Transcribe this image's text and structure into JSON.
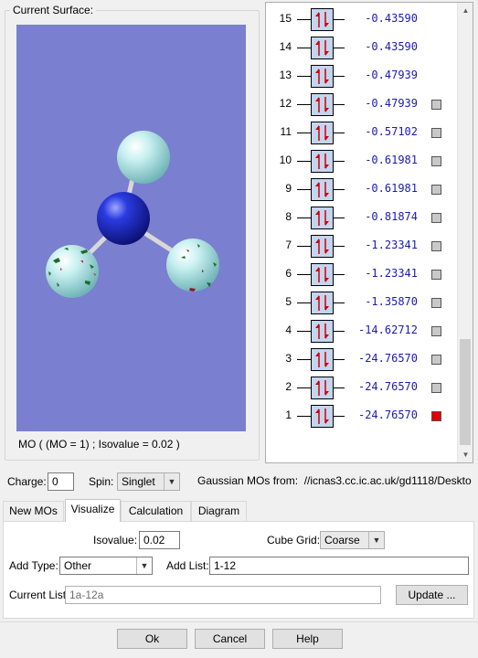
{
  "surface": {
    "legend": "Current Surface:",
    "caption": "MO ( (MO = 1) ; Isovalue = 0.02 )",
    "background_color": "#7b7fcf"
  },
  "mo_list": {
    "items": [
      {
        "num": "15",
        "energy": "-0.43590",
        "checkbox": "none"
      },
      {
        "num": "14",
        "energy": "-0.43590",
        "checkbox": "none"
      },
      {
        "num": "13",
        "energy": "-0.47939",
        "checkbox": "none"
      },
      {
        "num": "12",
        "energy": "-0.47939",
        "checkbox": "gray"
      },
      {
        "num": "11",
        "energy": "-0.57102",
        "checkbox": "gray"
      },
      {
        "num": "10",
        "energy": "-0.61981",
        "checkbox": "gray"
      },
      {
        "num": "9",
        "energy": "-0.61981",
        "checkbox": "gray"
      },
      {
        "num": "8",
        "energy": "-0.81874",
        "checkbox": "gray"
      },
      {
        "num": "7",
        "energy": "-1.23341",
        "checkbox": "gray"
      },
      {
        "num": "6",
        "energy": "-1.23341",
        "checkbox": "gray"
      },
      {
        "num": "5",
        "energy": "-1.35870",
        "checkbox": "gray"
      },
      {
        "num": "4",
        "energy": "-14.62712",
        "checkbox": "gray"
      },
      {
        "num": "3",
        "energy": "-24.76570",
        "checkbox": "gray"
      },
      {
        "num": "2",
        "energy": "-24.76570",
        "checkbox": "gray"
      },
      {
        "num": "1",
        "energy": "-24.76570",
        "checkbox": "red"
      }
    ],
    "scroll_up_icon": "triangle-up",
    "scroll_down_icon": "triangle-down"
  },
  "charge": {
    "label": "Charge:",
    "value": "0"
  },
  "spin": {
    "label": "Spin:",
    "value": "Singlet"
  },
  "source": {
    "label": "Gaussian MOs from:",
    "path": "//icnas3.cc.ic.ac.uk/gd1118/Deskto"
  },
  "tabs": [
    "New MOs",
    "Visualize",
    "Calculation",
    "Diagram"
  ],
  "active_tab": "Visualize",
  "visualize": {
    "isovalue_label": "Isovalue:",
    "isovalue": "0.02",
    "cube_grid_label": "Cube Grid:",
    "cube_grid": "Coarse",
    "add_type_label": "Add Type:",
    "add_type": "Other",
    "add_list_label": "Add List:",
    "add_list": "1-12",
    "current_list_label": "Current List:",
    "current_list": "1a-12a",
    "update_label": "Update ..."
  },
  "buttons": {
    "ok": "Ok",
    "cancel": "Cancel",
    "help": "Help"
  },
  "colors": {
    "energy_text": "#1a1ab0",
    "mo_box": "#c3d5ef",
    "selected_checkbox": "#e00000",
    "unselected_checkbox": "#c8c8c8"
  }
}
